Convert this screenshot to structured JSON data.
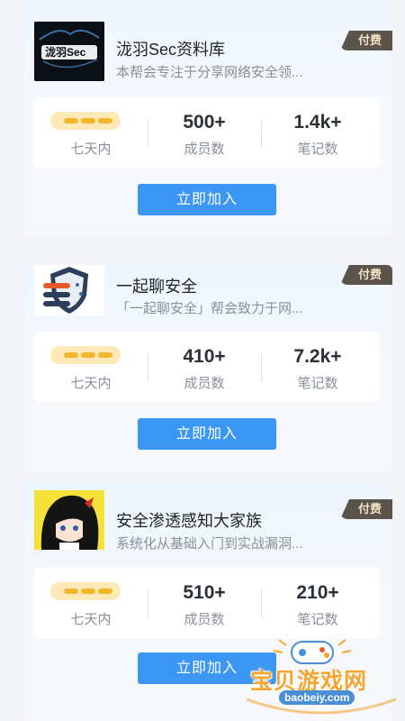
{
  "groups": [
    {
      "title": "泷羽Sec资料库",
      "description": "本帮会专注于分享网络安全领...",
      "badge": "付费",
      "logo_text": "泷羽Sec",
      "period": "七天内",
      "members": "500+",
      "members_label": "成员数",
      "notes": "1.4k+",
      "notes_label": "笔记数",
      "join": "立即加入"
    },
    {
      "title": "一起聊安全",
      "description": "「一起聊安全」帮会致力于网...",
      "badge": "付费",
      "period": "七天内",
      "members": "410+",
      "members_label": "成员数",
      "notes": "7.2k+",
      "notes_label": "笔记数",
      "join": "立即加入"
    },
    {
      "title": "安全渗透感知大家族",
      "description": "系统化从基础入门到实战漏洞...",
      "badge": "付费",
      "period": "七天内",
      "members": "510+",
      "members_label": "成员数",
      "notes": "210+",
      "notes_label": "笔记数",
      "join": "立即加入"
    }
  ],
  "watermark": {
    "text": "宝贝游戏网",
    "url": "baobeiy.com"
  },
  "colors": {
    "accent": "#3b97f3",
    "badge_bg": "#5a544c",
    "badge_text": "#f4e0c2",
    "rating": "#f6b62b"
  }
}
